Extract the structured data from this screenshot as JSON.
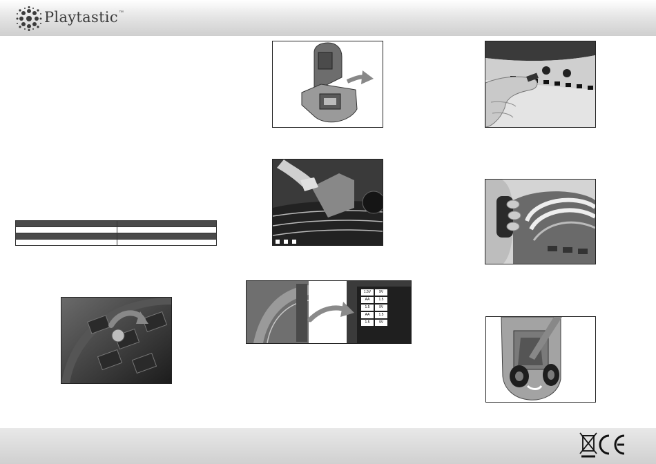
{
  "header": {
    "brand": "Playtastic",
    "trademark": "™"
  },
  "spec_table": {
    "rows": [
      [
        "",
        ""
      ],
      [
        "",
        ""
      ],
      [
        "",
        ""
      ],
      [
        "",
        ""
      ]
    ]
  },
  "battery_panel": {
    "rows": [
      {
        "left": "1.5V",
        "right": "9V"
      },
      {
        "left": "AA",
        "right": "1.5"
      },
      {
        "left": "1.5",
        "right": "9V"
      },
      {
        "left": "AA",
        "right": "1.5"
      },
      {
        "left": "1.5",
        "right": "9V"
      }
    ]
  },
  "footer": {
    "marks": [
      "weee-bin-icon",
      "ce-mark-icon"
    ]
  }
}
